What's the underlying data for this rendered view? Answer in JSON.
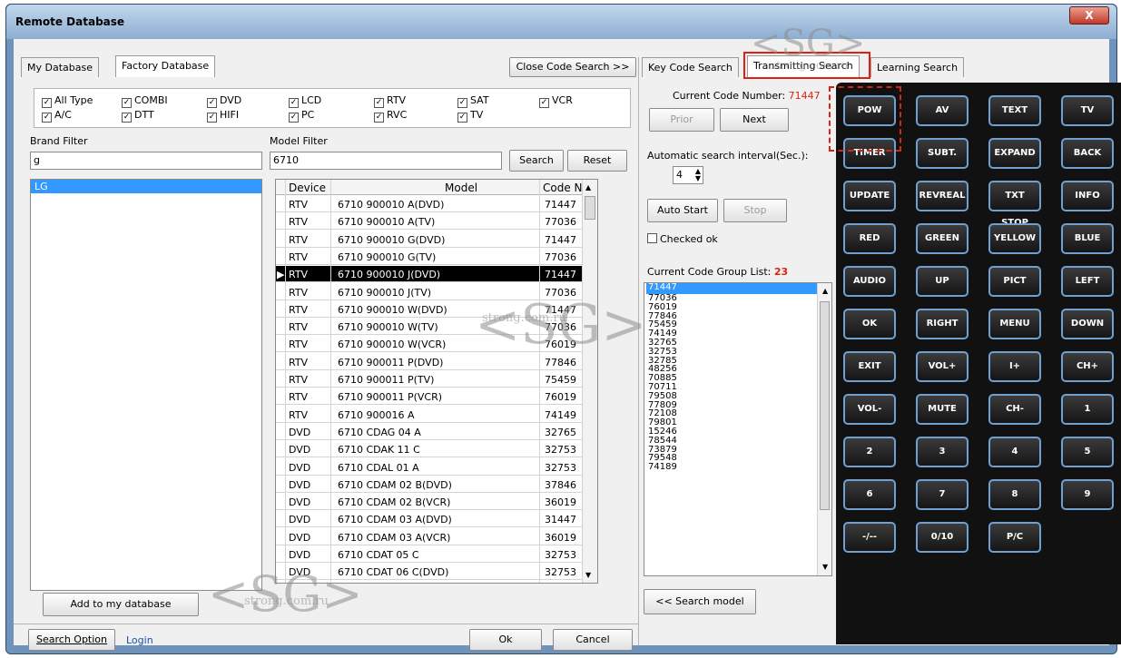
{
  "window": {
    "title": "Remote Database",
    "close": "X"
  },
  "left_tabs": {
    "my_database": "My Database",
    "factory_database": "Factory Database"
  },
  "close_code_search": "Close Code Search >>",
  "types": [
    {
      "label": "All Type"
    },
    {
      "label": "COMBI"
    },
    {
      "label": "DVD"
    },
    {
      "label": "LCD"
    },
    {
      "label": "RTV"
    },
    {
      "label": "SAT"
    },
    {
      "label": "VCR"
    },
    {
      "label": "A/C"
    },
    {
      "label": "DTT"
    },
    {
      "label": "HIFI"
    },
    {
      "label": "PC"
    },
    {
      "label": "RVC"
    },
    {
      "label": "TV"
    }
  ],
  "brand_filter": {
    "label": "Brand Filter",
    "value": "g",
    "items": [
      "LG"
    ]
  },
  "model_filter": {
    "label": "Model Filter",
    "value": "6710",
    "search": "Search",
    "reset": "Reset"
  },
  "table": {
    "headers": [
      "Device",
      "Model",
      "Code NO"
    ],
    "rows": [
      [
        "RTV",
        "6710 900010 A(DVD)",
        "71447"
      ],
      [
        "RTV",
        "6710 900010 A(TV)",
        "77036"
      ],
      [
        "RTV",
        "6710 900010 G(DVD)",
        "71447"
      ],
      [
        "RTV",
        "6710 900010 G(TV)",
        "77036"
      ],
      [
        "RTV",
        "6710 900010 J(DVD)",
        "71447"
      ],
      [
        "RTV",
        "6710 900010 J(TV)",
        "77036"
      ],
      [
        "RTV",
        "6710 900010 W(DVD)",
        "71447"
      ],
      [
        "RTV",
        "6710 900010 W(TV)",
        "77036"
      ],
      [
        "RTV",
        "6710 900010 W(VCR)",
        "76019"
      ],
      [
        "RTV",
        "6710 900011 P(DVD)",
        "77846"
      ],
      [
        "RTV",
        "6710 900011 P(TV)",
        "75459"
      ],
      [
        "RTV",
        "6710 900011 P(VCR)",
        "76019"
      ],
      [
        "RTV",
        "6710 900016 A",
        "74149"
      ],
      [
        "DVD",
        "6710 CDAG 04 A",
        "32765"
      ],
      [
        "DVD",
        "6710 CDAK 11 C",
        "32753"
      ],
      [
        "DVD",
        "6710 CDAL 01 A",
        "32753"
      ],
      [
        "DVD",
        "6710 CDAM 02 B(DVD)",
        "37846"
      ],
      [
        "DVD",
        "6710 CDAM 02 B(VCR)",
        "36019"
      ],
      [
        "DVD",
        "6710 CDAM 03 A(DVD)",
        "31447"
      ],
      [
        "DVD",
        "6710 CDAM 03 A(VCR)",
        "36019"
      ],
      [
        "DVD",
        "6710 CDAT 05 C",
        "32753"
      ],
      [
        "DVD",
        "6710 CDAT 06 C(DVD)",
        "32753"
      ]
    ],
    "selected_index": 4
  },
  "add_to_my_database": "Add to my database",
  "bottom": {
    "search_option": "Search Option",
    "login": "Login",
    "ok": "Ok",
    "cancel": "Cancel"
  },
  "right_tabs": {
    "key_code": "Key Code Search",
    "transmitting": "Transmitting Search",
    "learning": "Learning Search"
  },
  "current_code": {
    "label": "Current Code Number:",
    "value": "71447",
    "prior": "Prior",
    "next": "Next"
  },
  "interval": {
    "label": "Automatic search interval(Sec.):",
    "value": "4"
  },
  "auto_start": "Auto Start",
  "stop": "Stop",
  "checked_ok": "Checked ok",
  "group_list": {
    "label": "Current Code Group List:",
    "count": "23",
    "codes": [
      "71447",
      "77036",
      "76019",
      "77846",
      "75459",
      "74149",
      "32765",
      "32753",
      "32785",
      "48256",
      "70885",
      "70711",
      "79508",
      "77809",
      "72108",
      "79801",
      "15246",
      "78544",
      "73879",
      "79548",
      "74189"
    ]
  },
  "search_model": "<< Search model",
  "remote_keys": [
    "POW",
    "AV",
    "TEXT",
    "TV",
    "TIMER",
    "SUBT.",
    "EXPAND",
    "BACK",
    "UPDATE",
    "REVREAL",
    "TXT STOP",
    "INFO",
    "RED",
    "GREEN",
    "YELLOW",
    "BLUE",
    "AUDIO",
    "UP",
    "PICT",
    "LEFT",
    "OK",
    "RIGHT",
    "MENU",
    "DOWN",
    "EXIT",
    "VOL+",
    "I+",
    "CH+",
    "VOL-",
    "MUTE",
    "CH-",
    "1",
    "2",
    "3",
    "4",
    "5",
    "6",
    "7",
    "8",
    "9",
    "-/--",
    "0/10",
    "P/C"
  ],
  "watermark_text": "strong.com.ru",
  "colors": {
    "accent_red": "#d21",
    "selection_blue": "#3399ff",
    "key_border": "#6fa0d0"
  }
}
